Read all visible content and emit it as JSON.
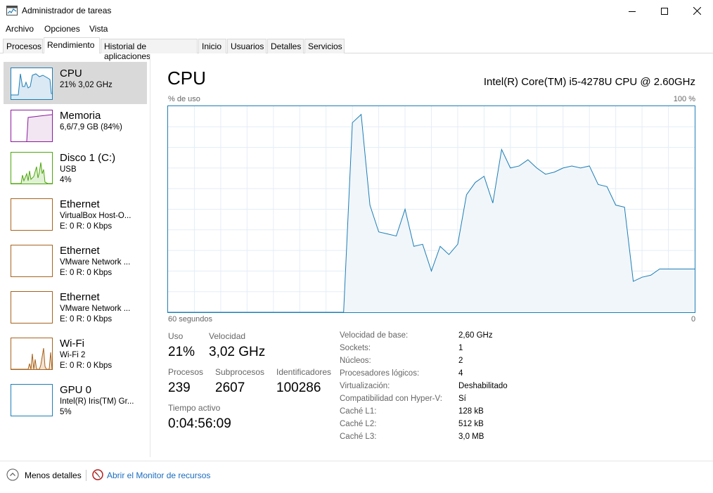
{
  "window": {
    "title": "Administrador de tareas",
    "icon": "task-manager-icon"
  },
  "menu": [
    "Archivo",
    "Opciones",
    "Vista"
  ],
  "tabs": [
    "Procesos",
    "Rendimiento",
    "Historial de aplicaciones",
    "Inicio",
    "Usuarios",
    "Detalles",
    "Servicios"
  ],
  "active_tab": "Rendimiento",
  "sidebar": [
    {
      "title": "CPU",
      "sub1": "21%  3,02 GHz",
      "sub2": "",
      "sub3": "",
      "color": "#1c7eb5"
    },
    {
      "title": "Memoria",
      "sub1": "6,6/7,9 GB (84%)",
      "sub2": "",
      "sub3": "",
      "color": "#8b1a9b"
    },
    {
      "title": "Disco 1 (C:)",
      "sub1": "USB",
      "sub2": "4%",
      "sub3": "",
      "color": "#4da60c"
    },
    {
      "title": "Ethernet",
      "sub1": "VirtualBox Host-O...",
      "sub2": "E: 0  R: 0 Kbps",
      "sub3": "",
      "color": "#a7631e"
    },
    {
      "title": "Ethernet",
      "sub1": "VMware Network ...",
      "sub2": "E: 0  R: 0 Kbps",
      "sub3": "",
      "color": "#a7631e"
    },
    {
      "title": "Ethernet",
      "sub1": "VMware Network ...",
      "sub2": "E: 0  R: 0 Kbps",
      "sub3": "",
      "color": "#a7631e"
    },
    {
      "title": "Wi-Fi",
      "sub1": "Wi-Fi 2",
      "sub2": "E: 0  R: 0 Kbps",
      "sub3": "",
      "color": "#a7631e"
    },
    {
      "title": "GPU 0",
      "sub1": "Intel(R) Iris(TM) Gr...",
      "sub2": "5%",
      "sub3": "",
      "color": "#1c7eb5"
    }
  ],
  "main": {
    "title": "CPU",
    "model": "Intel(R) Core(TM) i5-4278U CPU @ 2.60GHz",
    "graph_label": "% de uso",
    "graph_max": "100 %",
    "graph_time": "60 segundos",
    "graph_zero": "0",
    "stats": {
      "uso_label": "Uso",
      "uso_value": "21%",
      "velocidad_label": "Velocidad",
      "velocidad_value": "3,02 GHz",
      "procesos_label": "Procesos",
      "procesos_value": "239",
      "subprocesos_label": "Subprocesos",
      "subprocesos_value": "2607",
      "identificadores_label": "Identificadores",
      "identificadores_value": "100286",
      "tiempo_label": "Tiempo activo",
      "tiempo_value": "0:04:56:09"
    },
    "info": [
      {
        "label": "Velocidad de base:",
        "value": "2,60 GHz"
      },
      {
        "label": "Sockets:",
        "value": "1"
      },
      {
        "label": "Núcleos:",
        "value": "2"
      },
      {
        "label": "Procesadores lógicos:",
        "value": "4"
      },
      {
        "label": "Virtualización:",
        "value": "Deshabilitado"
      },
      {
        "label": "Compatibilidad con Hyper-V:",
        "value": "Sí"
      },
      {
        "label": "Caché L1:",
        "value": "128 kB"
      },
      {
        "label": "Caché L2:",
        "value": "512 kB"
      },
      {
        "label": "Caché L3:",
        "value": "3,0 MB"
      }
    ]
  },
  "footer": {
    "less_details": "Menos detalles",
    "resource_monitor": "Abrir el Monitor de recursos"
  },
  "chart_data": {
    "type": "area",
    "x": [
      60,
      40,
      39,
      38,
      37,
      36,
      35,
      34,
      33,
      32,
      31,
      30,
      29,
      28,
      27,
      26,
      25,
      24,
      23,
      22,
      21,
      20,
      19,
      18,
      17,
      16,
      15,
      14,
      13,
      12,
      11,
      10,
      9,
      8,
      7,
      6,
      5,
      4,
      3,
      2,
      1,
      0
    ],
    "values": [
      0,
      0,
      92,
      96,
      52,
      39,
      38,
      37,
      50,
      32,
      33,
      20,
      32,
      28,
      33,
      57,
      63,
      66,
      53,
      79,
      70,
      71,
      74,
      70,
      67,
      68,
      70,
      71,
      70,
      71,
      62,
      61,
      52,
      51,
      15,
      17,
      18,
      21,
      21,
      21,
      21,
      21
    ],
    "series": [
      {
        "name": "",
        "color": "#1c7eb5"
      }
    ],
    "xlabel": "60 segundos",
    "ylabel": "% de uso",
    "xlim": [
      60,
      0
    ],
    "ylim": [
      0,
      100
    ],
    "grid": true
  }
}
